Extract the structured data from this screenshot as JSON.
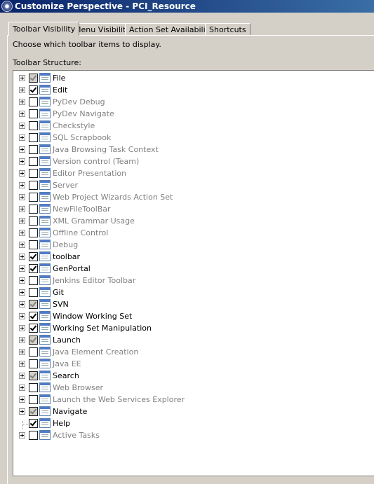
{
  "window": {
    "title": "Customize Perspective - PCI_Resource",
    "icon": "eclipse-icon"
  },
  "tabs": [
    {
      "label": "Toolbar Visibility",
      "active": true
    },
    {
      "label": "Menu Visibility",
      "active": false
    },
    {
      "label": "Action Set Availability",
      "active": false
    },
    {
      "label": "Shortcuts",
      "active": false
    }
  ],
  "description": "Choose which toolbar items to display.",
  "structure_label": "Toolbar Structure:",
  "tree": {
    "items": [
      {
        "label": "File",
        "state": "gray",
        "enabled": true,
        "expandable": true
      },
      {
        "label": "Edit",
        "state": "checked",
        "enabled": true,
        "expandable": true
      },
      {
        "label": "PyDev Debug",
        "state": "unchecked",
        "enabled": false,
        "expandable": true
      },
      {
        "label": "PyDev Navigate",
        "state": "unchecked",
        "enabled": false,
        "expandable": true
      },
      {
        "label": "Checkstyle",
        "state": "unchecked",
        "enabled": false,
        "expandable": true
      },
      {
        "label": "SQL Scrapbook",
        "state": "unchecked",
        "enabled": false,
        "expandable": true
      },
      {
        "label": "Java Browsing Task Context",
        "state": "unchecked",
        "enabled": false,
        "expandable": true
      },
      {
        "label": "Version control (Team)",
        "state": "unchecked",
        "enabled": false,
        "expandable": true
      },
      {
        "label": "Editor Presentation",
        "state": "unchecked",
        "enabled": false,
        "expandable": true
      },
      {
        "label": "Server",
        "state": "unchecked",
        "enabled": false,
        "expandable": true
      },
      {
        "label": "Web Project Wizards Action Set",
        "state": "unchecked",
        "enabled": false,
        "expandable": true
      },
      {
        "label": "NewFileToolBar",
        "state": "unchecked",
        "enabled": false,
        "expandable": true
      },
      {
        "label": "XML Grammar Usage",
        "state": "unchecked",
        "enabled": false,
        "expandable": true
      },
      {
        "label": "Offline Control",
        "state": "unchecked",
        "enabled": false,
        "expandable": true
      },
      {
        "label": "Debug",
        "state": "unchecked",
        "enabled": false,
        "expandable": true
      },
      {
        "label": "toolbar",
        "state": "checked",
        "enabled": true,
        "expandable": true
      },
      {
        "label": "GenPortal",
        "state": "checked",
        "enabled": true,
        "expandable": true
      },
      {
        "label": "Jenkins Editor Toolbar",
        "state": "unchecked",
        "enabled": false,
        "expandable": true
      },
      {
        "label": "Git",
        "state": "unchecked",
        "enabled": true,
        "expandable": true
      },
      {
        "label": "SVN",
        "state": "gray",
        "enabled": true,
        "expandable": true
      },
      {
        "label": "Window Working Set",
        "state": "checked",
        "enabled": true,
        "expandable": true
      },
      {
        "label": "Working Set Manipulation",
        "state": "checked",
        "enabled": true,
        "expandable": true
      },
      {
        "label": "Launch",
        "state": "gray",
        "enabled": true,
        "expandable": true
      },
      {
        "label": "Java Element Creation",
        "state": "unchecked",
        "enabled": false,
        "expandable": true
      },
      {
        "label": "Java EE",
        "state": "unchecked",
        "enabled": false,
        "expandable": true
      },
      {
        "label": "Search",
        "state": "gray",
        "enabled": true,
        "expandable": true
      },
      {
        "label": "Web Browser",
        "state": "unchecked",
        "enabled": false,
        "expandable": true
      },
      {
        "label": "Launch the Web Services Explorer",
        "state": "unchecked",
        "enabled": false,
        "expandable": true
      },
      {
        "label": "Navigate",
        "state": "gray",
        "enabled": true,
        "expandable": true
      },
      {
        "label": "Help",
        "state": "checked",
        "enabled": true,
        "expandable": false
      },
      {
        "label": "Active Tasks",
        "state": "unchecked",
        "enabled": false,
        "expandable": true
      }
    ]
  }
}
